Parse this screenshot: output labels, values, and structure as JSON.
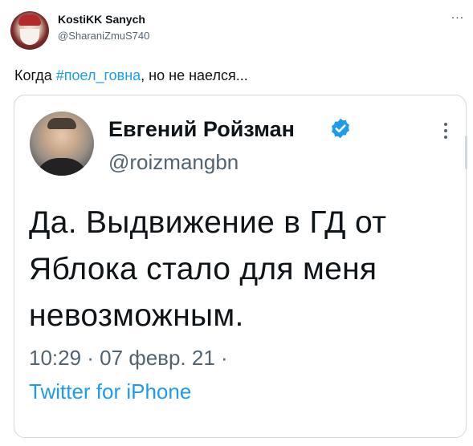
{
  "tweet": {
    "author_name": "KostiKK Sanych",
    "author_handle": "@SharaniZmuS740",
    "more_label": "...",
    "text_before": "Когда ",
    "hashtag": "#поел_говна",
    "text_after": ", но не наелся..."
  },
  "quoted_tweet": {
    "author_name": "Евгений Ройзман",
    "author_handle": "@roizmangbn",
    "verified": true,
    "body_lines": [
      "Да. Выдвижение в ГД от",
      "Яблока стало для меня",
      "невозможным."
    ],
    "timestamp": "10:29 · 07 февр. 21 ·",
    "source": "Twitter for iPhone"
  },
  "colors": {
    "accent": "#1d9bf0",
    "text_primary": "#0f1419",
    "text_secondary": "#536471",
    "border": "#cfd9de"
  },
  "icons": {
    "verified": "verified-badge-icon",
    "more": "more-dots-icon"
  }
}
